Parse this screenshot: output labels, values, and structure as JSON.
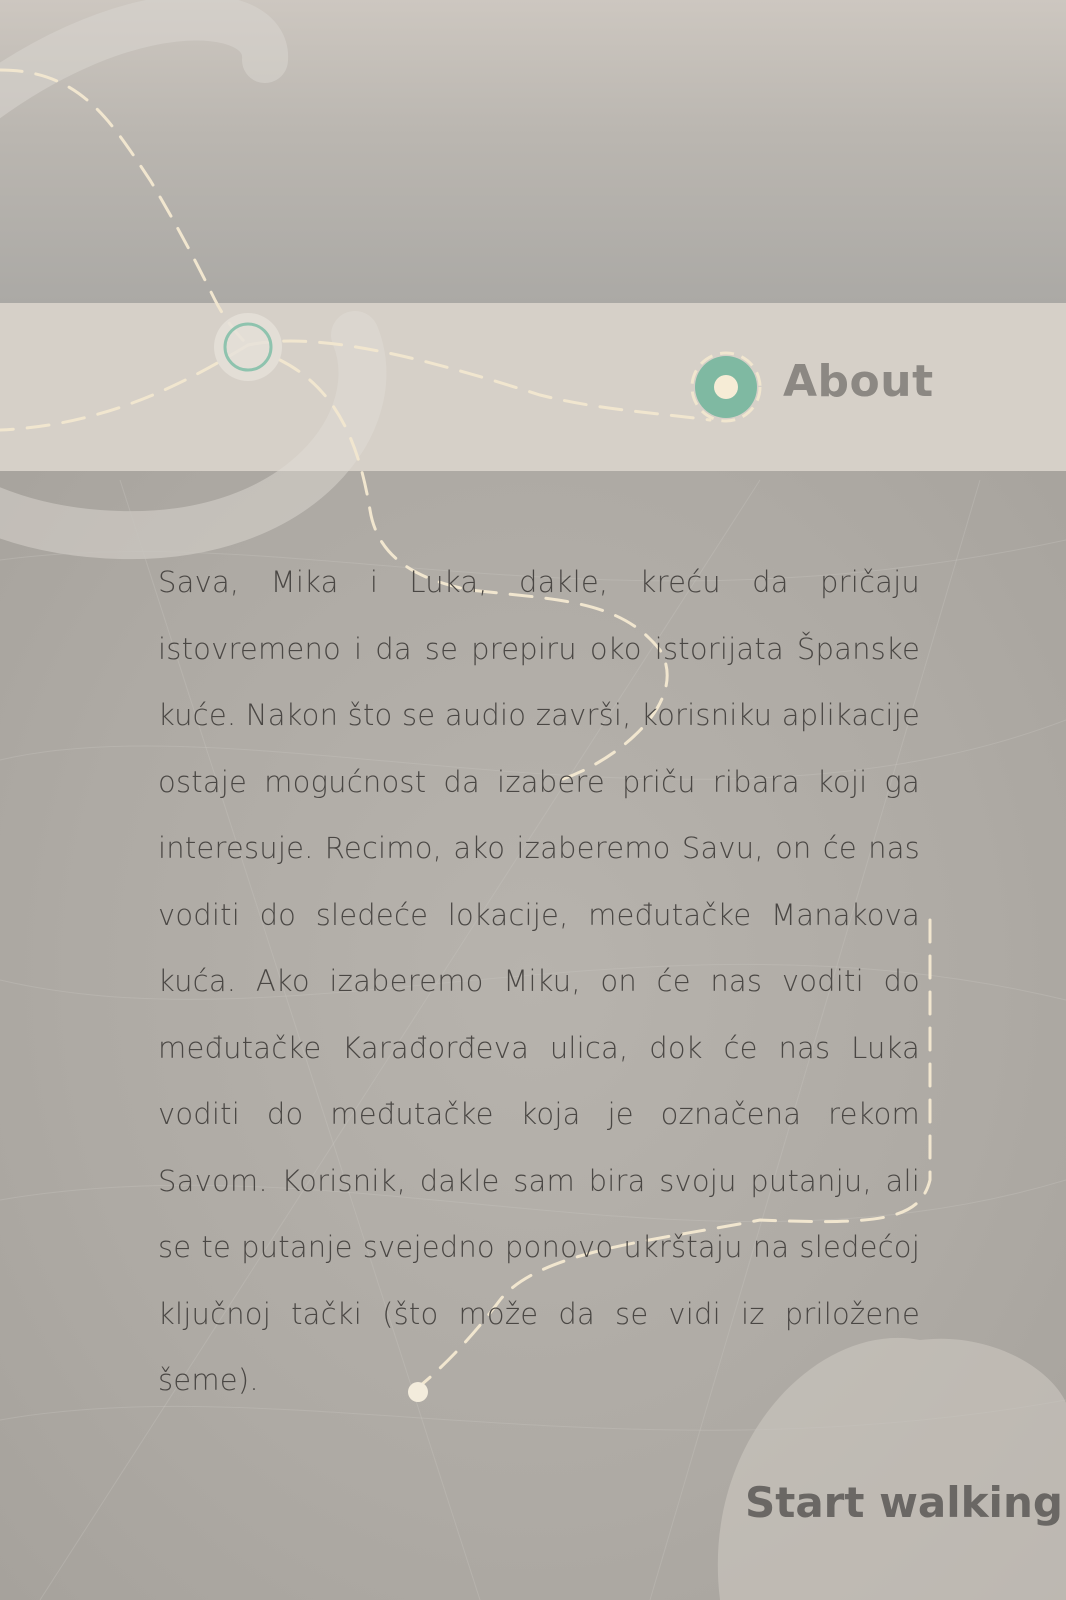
{
  "header": {
    "section_label": "About"
  },
  "story": {
    "paragraph": "Sava, Mika i Luka, dakle, kreću da pričaju istovremeno i da se prepiru oko istorijata Španske kuće. Nakon što se audio završi, korisniku aplikacije ostaje mogućnost da izabere priču ribara koji ga interesuje. Recimo, ako izaberemo Savu, on će nas voditi do sledeće lokacije, međutačke Manakova kuća. Ako izaberemo Miku, on će nas voditi do međutačke Karađorđeva ulica, dok će nas Luka voditi do međutačke koja je označena rekom Savom. Korisnik, dakle sam bira svoju putanju, ali se te putanje svejedno ponovo ukrštaju na sledećoj ključnoj tački (što može da se vidi iz priložene šeme)."
  },
  "actions": {
    "start_label": "Start walking"
  },
  "colors": {
    "accent_teal": "#7fb9a2",
    "path_cream": "#f1e6cf",
    "text": "#4a4744"
  },
  "icons": {
    "about_marker": "location-dot-icon",
    "path_marker": "waypoint-ring-icon"
  }
}
